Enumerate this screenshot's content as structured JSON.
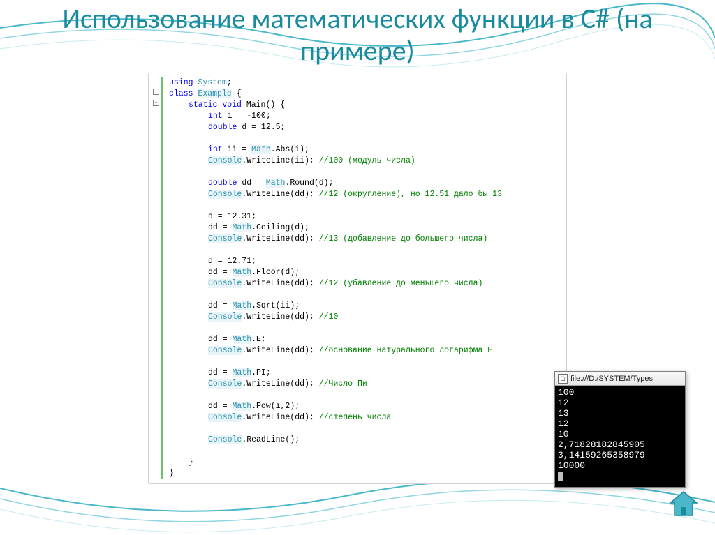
{
  "title": "Использование математических функции в C# (на примере)",
  "code": {
    "l1_kw1": "using",
    "l1_cls": "System",
    "l1_end": ";",
    "l2_kw1": "class",
    "l2_cls": "Example",
    "l2_end": " {",
    "l3_kw1": "static",
    "l3_kw2": "void",
    "l3_name": "Main() {",
    "l4_kw": "int",
    "l4_rest": " i = -100;",
    "l5_kw": "double",
    "l5_rest": " d = 12.5;",
    "l6_kw": "int",
    "l6_rest": " ii = ",
    "l6_cls": "Math",
    "l6_end": ".Abs(i);",
    "l7_cls": "Console",
    "l7_rest": ".WriteLine(ii); ",
    "l7_cmt": "//100 (модуль числа)",
    "l8_kw": "double",
    "l8_rest": " dd = ",
    "l8_cls": "Math",
    "l8_end": ".Round(d);",
    "l9_cls": "Console",
    "l9_rest": ".WriteLine(dd); ",
    "l9_cmt": "//12 (округление), но 12.51 дало бы 13",
    "l10": "d = 12.31;",
    "l11_pre": "dd = ",
    "l11_cls": "Math",
    "l11_end": ".Ceiling(d);",
    "l12_cls": "Console",
    "l12_rest": ".WriteLine(dd); ",
    "l12_cmt": "//13 (добавление до большего числа)",
    "l13": "d = 12.71;",
    "l14_pre": "dd = ",
    "l14_cls": "Math",
    "l14_end": ".Floor(d);",
    "l15_cls": "Console",
    "l15_rest": ".WriteLine(dd); ",
    "l15_cmt": "//12 (убавление до меньшего числа)",
    "l16_pre": "dd = ",
    "l16_cls": "Math",
    "l16_end": ".Sqrt(ii);",
    "l17_cls": "Console",
    "l17_rest": ".WriteLine(dd); ",
    "l17_cmt": "//10",
    "l18_pre": "dd = ",
    "l18_cls": "Math",
    "l18_end": ".E;",
    "l19_cls": "Console",
    "l19_rest": ".WriteLine(dd); ",
    "l19_cmt": "//основание натурального логарифма E",
    "l20_pre": "dd = ",
    "l20_cls": "Math",
    "l20_end": ".PI;",
    "l21_cls": "Console",
    "l21_rest": ".WriteLine(dd); ",
    "l21_cmt": "//Число Пи",
    "l22_pre": "dd = ",
    "l22_cls": "Math",
    "l22_end": ".Pow(i,2);",
    "l23_cls": "Console",
    "l23_rest": ".WriteLine(dd); ",
    "l23_cmt": "//степень числа",
    "l24_cls": "Console",
    "l24_rest": ".ReadLine();",
    "l25": "}",
    "l26": "}"
  },
  "console": {
    "title": "file:///D:/SYSTEM/Types",
    "lines": [
      "100",
      "12",
      "13",
      "12",
      "10",
      "2,71828182845905",
      "3,14159265358979",
      "10000"
    ]
  }
}
